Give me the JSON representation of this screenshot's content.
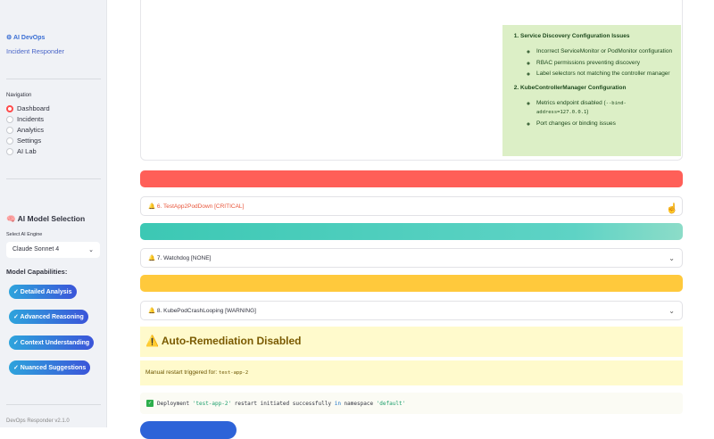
{
  "sidebar": {
    "brand": "⚙ AI DevOps",
    "subtitle": "Incident Responder",
    "nav_label": "Navigation",
    "nav": [
      {
        "label": "Dashboard",
        "selected": true
      },
      {
        "label": "Incidents"
      },
      {
        "label": "Analytics"
      },
      {
        "label": "Settings"
      },
      {
        "label": "AI Lab"
      }
    ],
    "model_heading": "🧠 AI Model Selection",
    "engine_label": "Select AI Engine",
    "engine_value": "Claude Sonnet 4",
    "caps_heading": "Model Capabilities:",
    "caps": [
      "✓ Detailed Analysis",
      "✓ Advanced Reasoning",
      "✓ Context Understanding",
      "✓ Nuanced Suggestions"
    ],
    "version": "DevOps Responder v2.1.0"
  },
  "analysis": {
    "items": [
      {
        "title": "Service Discovery Configuration Issues",
        "bullets": [
          "Incorrect ServiceMonitor or PodMonitor configuration",
          "RBAC permissions preventing discovery",
          "Label selectors not matching the controller manager"
        ]
      },
      {
        "title": "KubeControllerManager Configuration",
        "bullets": [
          "Metrics endpoint disabled (",
          "Port changes or binding issues"
        ],
        "code": "--bind-address=127.0.0.1",
        "code_suffix": ")"
      }
    ]
  },
  "alerts": [
    {
      "label": "🔔 6. TestApp2PodDown [CRITICAL]",
      "color": "#ff5a5a",
      "text_color": "#e8553a"
    },
    {
      "label": "🔔 7. Watchdog [NONE]",
      "color": "#3cc8c0"
    },
    {
      "label": "🔔 8. KubePodCrashLooping [WARNING]",
      "color": "#ffc93c"
    }
  ],
  "remediation": {
    "title": "⚠️ Auto-Remediation Disabled",
    "manual_text": "Manual restart triggered for: ",
    "manual_target": "test-app-2",
    "result": {
      "p1": "Deployment ",
      "s1": "'test-app-2'",
      "p2": " restart initiated successfully ",
      "kw": "in",
      "p3": " namespace ",
      "s2": "'default'"
    }
  }
}
